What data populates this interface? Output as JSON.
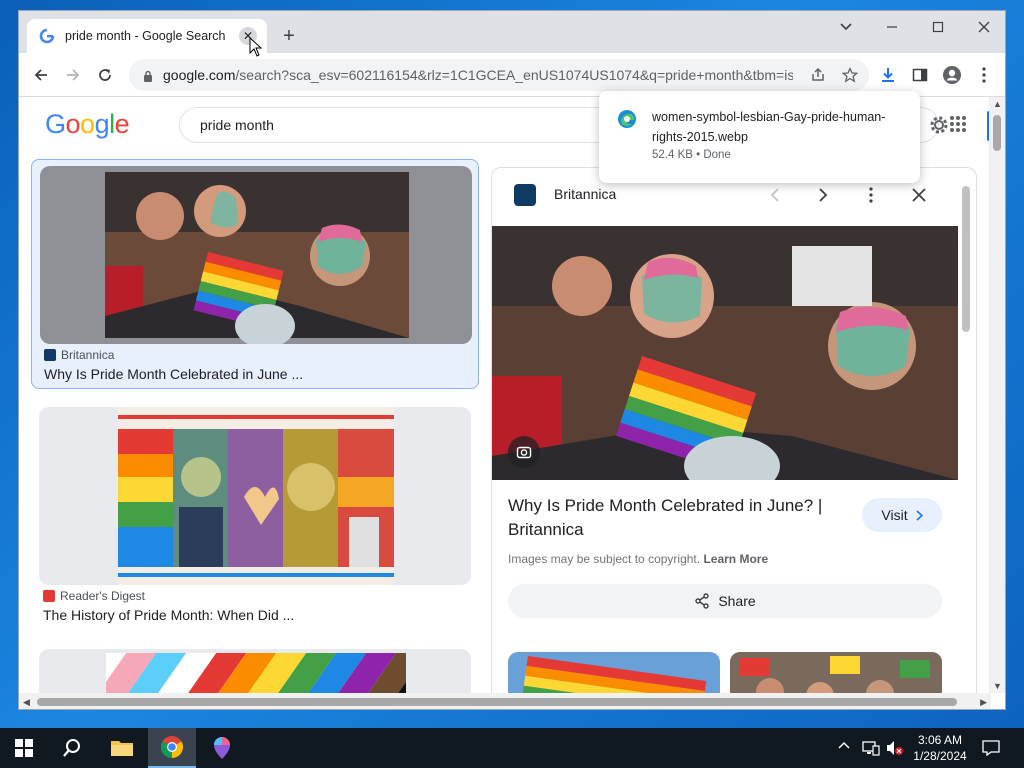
{
  "browser": {
    "tab_title": "pride month - Google Search",
    "tab_close": "✕",
    "new_tab": "+",
    "url_main": "google.com",
    "url_rest": "/search?sca_esv=602116154&rlz=1C1GCEA_enUS1074US1074&q=pride+month&tbm=is..."
  },
  "page": {
    "search_query": "pride month"
  },
  "results": [
    {
      "source": "Britannica",
      "title": "Why Is Pride Month Celebrated in June ..."
    },
    {
      "source": "Reader's Digest",
      "title": "The History of Pride Month: When Did ..."
    }
  ],
  "preview": {
    "source": "Britannica",
    "title": "Why Is Pride Month Celebrated in June? | Britannica",
    "visit_label": "Visit",
    "copyright_text": "Images may be subject to copyright.",
    "learn_more": "Learn More",
    "share_label": "Share"
  },
  "download": {
    "filename": "women-symbol-lesbian-Gay-pride-human-rights-2015.webp",
    "status": "52.4 KB • Done"
  },
  "taskbar": {
    "time": "3:06 AM",
    "date": "1/28/2024"
  },
  "colors": {
    "accent": "#1a73e8",
    "selected_bg": "#e8f0fe",
    "taskbar": "#101820"
  }
}
